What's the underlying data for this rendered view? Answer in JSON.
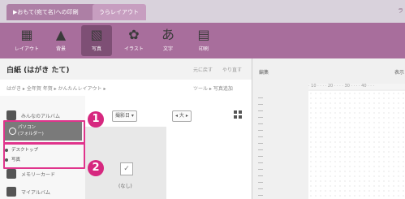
{
  "tabs": [
    {
      "label": "▶おもて(宛て名)への印刷"
    },
    {
      "label": "うらレイアウト"
    }
  ],
  "tab_edge": "ラ",
  "toolbar": {
    "buttons": [
      {
        "label": "レイアウト",
        "icon": "layout-icon"
      },
      {
        "label": "背景",
        "icon": "background-icon"
      },
      {
        "label": "写真",
        "icon": "photo-icon",
        "active": true
      },
      {
        "label": "イラスト",
        "icon": "illustration-icon"
      },
      {
        "label": "文字",
        "icon": "text-icon"
      },
      {
        "label": "印刷",
        "icon": "printer-icon"
      }
    ]
  },
  "titlebar": {
    "title": "白紙 (はがき たて)",
    "right1": "元に戻す",
    "right2": "やり直す"
  },
  "breadcrumb": "はがき ▸ 全年賀 年賀 ▸ かんたんレイアウト ▸",
  "tools_label": "ツール ▸ 写真追加",
  "left_panel": {
    "items": [
      {
        "label": "みんなのアルバム"
      },
      {
        "label": "パソコン"
      },
      {
        "label": "メモリーカード"
      },
      {
        "label": "マイアルバム"
      }
    ],
    "highlighted_label_1": "パソコン",
    "highlighted_label_2": "(フォルダー)",
    "sub_items": [
      "デスクトップ",
      "写真"
    ]
  },
  "controls": {
    "sort_select": "撮影日 ▾",
    "size_select": "◂ 大 ▸",
    "badge1": "1",
    "badge2": "2"
  },
  "thumb_caption": "(なし)",
  "right_panel": {
    "label_left": "編集",
    "label_right": "表示",
    "ruler": "· 10 · · · · 20 · · · · 30 · · · · 40 · · ·"
  },
  "colors": {
    "toolbar": "#a86e9c",
    "highlight_border": "#e0348c",
    "badge": "#d6287f"
  }
}
